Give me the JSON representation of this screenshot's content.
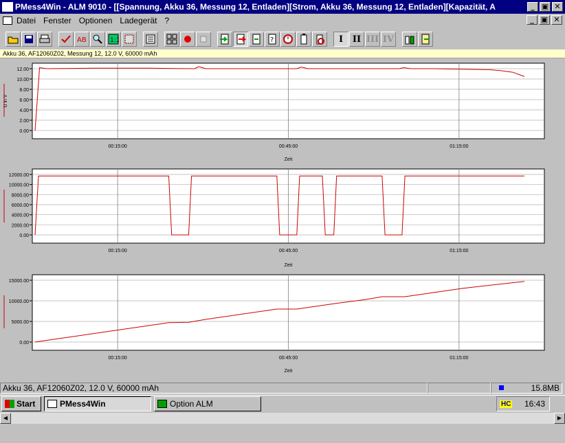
{
  "window": {
    "title": "PMess4Win - ALM 9010 - [[Spannung, Akku 36, Messung 12, Entladen][Strom, Akku 36, Messung 12, Entladen][Kapazität, A",
    "minimize": "_",
    "restore": "▣",
    "close": "✕"
  },
  "menu": {
    "items": [
      "Datei",
      "Fenster",
      "Optionen",
      "Ladegerät",
      "?"
    ]
  },
  "toolbar": {
    "buttons": [
      "open-icon",
      "save-icon",
      "print-icon",
      "check-icon",
      "search-icon",
      "zoom-icon",
      "fit-icon",
      "settings-icon",
      "grid-icon",
      "record-icon",
      "stop-icon",
      "import-icon",
      "export-icon",
      "next-icon",
      "prev-icon",
      "timer-icon",
      "refresh-icon",
      "delete-icon"
    ],
    "roman": [
      "I",
      "II",
      "III",
      "IV"
    ]
  },
  "info_line": "Akku 36,  AF12060Z02,  Messung 12,  12.0 V,  60000 mAh",
  "status": {
    "left": "Akku 36,  AF12060Z02,  12.0 V,  60000 mAh",
    "memory": "15.8MB"
  },
  "taskbar": {
    "start": "Start",
    "tasks": [
      "PMess4Win",
      "Option ALM"
    ],
    "clock": "16:43",
    "tray_icon": "HC"
  },
  "colors": {
    "curve": "#cc0000",
    "grid": "#808080",
    "titlebar": "#000080"
  },
  "chart_data": [
    {
      "type": "line",
      "ylabel": "U in V",
      "xlabel": "Zeit",
      "ylim": [
        0,
        12
      ],
      "yticks": [
        "12.00",
        "10.00",
        "8.00",
        "6.00",
        "4.00",
        "2.00",
        "0.00"
      ],
      "xticks": [
        "00:15:00",
        "00:45:00",
        "01:15:00"
      ],
      "series": [
        {
          "x": [
            0,
            0.8,
            2,
            10,
            20,
            28,
            28.8,
            30,
            40,
            46,
            46.8,
            48,
            60,
            64,
            64.8,
            66,
            70,
            80,
            82,
            84,
            85.2,
            86
          ],
          "values": [
            0,
            12.2,
            12.0,
            12.1,
            12.1,
            12.0,
            12.4,
            12.0,
            12.0,
            12.0,
            12.3,
            12.0,
            12.0,
            12.0,
            12.2,
            12.0,
            12.0,
            11.8,
            11.6,
            11.3,
            10.8,
            10.5
          ]
        }
      ]
    },
    {
      "type": "line",
      "ylabel": "",
      "xlabel": "Zeit",
      "ylim": [
        0,
        12000
      ],
      "yticks": [
        "12000.00",
        "10000.00",
        "8000.00",
        "6000.00",
        "4000.00",
        "2000.00",
        "0.00"
      ],
      "xticks": [
        "00:15:00",
        "00:45:00",
        "01:15:00"
      ],
      "series": [
        {
          "x": [
            0,
            0.6,
            23.5,
            24,
            27,
            27.5,
            42.5,
            43,
            46,
            46.5,
            50.5,
            51,
            52.5,
            53,
            61,
            61.5,
            64.5,
            65,
            86
          ],
          "values": [
            0,
            11700,
            11700,
            0,
            0,
            11700,
            11700,
            0,
            0,
            11700,
            11700,
            0,
            0,
            11700,
            11700,
            0,
            0,
            11700,
            11700
          ]
        }
      ]
    },
    {
      "type": "line",
      "ylabel": "",
      "xlabel": "Zeit",
      "ylim": [
        0,
        15000
      ],
      "yticks": [
        "15000.00",
        "10000.00",
        "5000.00",
        "0.00"
      ],
      "xticks": [
        "00:15:00",
        "00:45:00",
        "01:15:00"
      ],
      "series": [
        {
          "x": [
            0,
            5,
            10,
            15,
            20,
            23.5,
            27,
            30,
            35,
            40,
            42.5,
            46,
            50.5,
            53,
            58,
            61,
            65,
            70,
            75,
            80,
            86
          ],
          "values": [
            0,
            1000,
            2000,
            3000,
            4000,
            4700,
            4800,
            5500,
            6500,
            7500,
            8000,
            8000,
            8900,
            9400,
            10300,
            11000,
            11000,
            12000,
            13000,
            13800,
            14700
          ]
        }
      ]
    }
  ]
}
